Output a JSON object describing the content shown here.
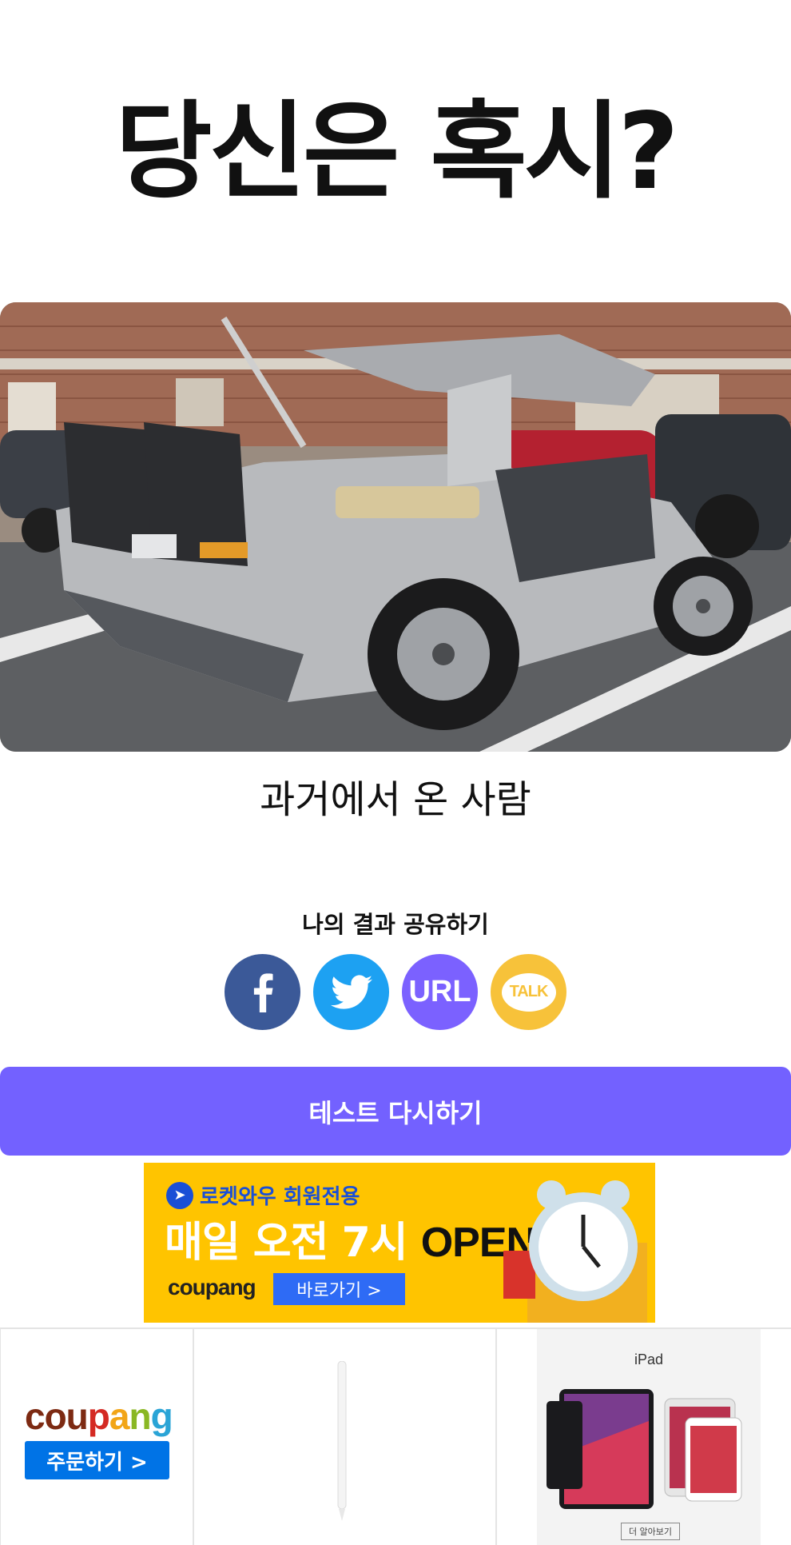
{
  "page": {
    "title": "당신은 혹시?",
    "result_name": "과거에서 온 사람"
  },
  "share": {
    "title": "나의 결과 공유하기",
    "buttons": [
      {
        "name": "facebook",
        "label": "f",
        "color": "#3b5998"
      },
      {
        "name": "twitter",
        "label": "",
        "color": "#1da1f2"
      },
      {
        "name": "url",
        "label": "URL",
        "color": "#7b61ff"
      },
      {
        "name": "kakaotalk",
        "label": "TALK",
        "color": "#f7c23a"
      }
    ]
  },
  "retry": {
    "label": "테스트 다시하기",
    "color": "#7361ff"
  },
  "ad_banner": {
    "tag": "로켓와우 회원전용",
    "headline_white": "매일 오전 7시",
    "headline_dark": "OPEN",
    "brand": "coupang",
    "button": "바로가기 >",
    "background": "#ffc400"
  },
  "product_strip": {
    "logo": [
      "cou",
      "p",
      "a",
      "n",
      "g"
    ],
    "order_button": "주문하기 >",
    "ipad_label": "iPad",
    "ipad_more": "더 알아보기"
  }
}
